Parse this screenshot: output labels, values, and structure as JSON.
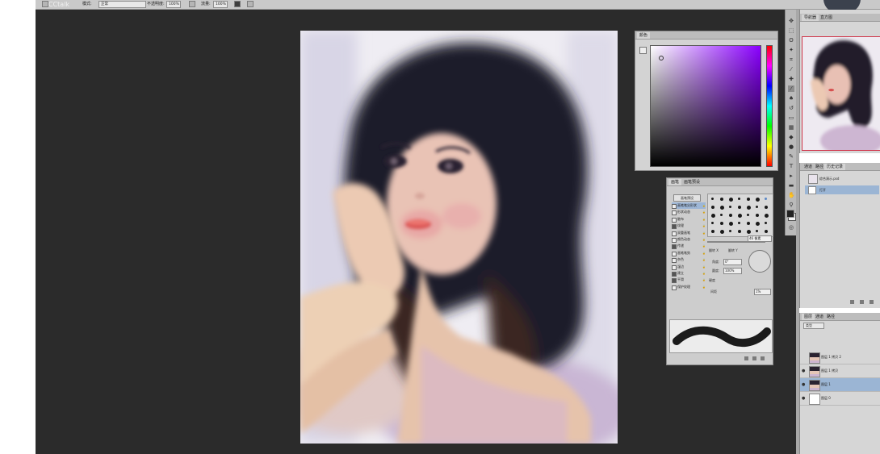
{
  "app": {
    "watermark": "CCtalk",
    "accent_color": "#2b2b2b"
  },
  "options_bar": {
    "mode_label": "模式:",
    "mode_value": "正常",
    "opacity_label": "不透明度:",
    "opacity_value": "100%",
    "flow_label": "流量:",
    "flow_value": "100%"
  },
  "color_panel": {
    "tab": "颜色",
    "hue": "#8a00ff"
  },
  "brush_panel": {
    "tabs": [
      "画笔",
      "画笔预设"
    ],
    "presets_button": "画笔预设",
    "items": [
      {
        "label": "画笔笔尖形状",
        "checked": false,
        "selected": true
      },
      {
        "label": "形状动态",
        "checked": false
      },
      {
        "label": "散布",
        "checked": false
      },
      {
        "label": "纹理",
        "checked": true
      },
      {
        "label": "双重画笔",
        "checked": false
      },
      {
        "label": "颜色动态",
        "checked": false
      },
      {
        "label": "传递",
        "checked": true
      },
      {
        "label": "画笔笔势",
        "checked": false
      },
      {
        "label": "杂色",
        "checked": false
      },
      {
        "label": "湿边",
        "checked": false
      },
      {
        "label": "建立",
        "checked": true
      },
      {
        "label": "平滑",
        "checked": true
      },
      {
        "label": "保护纹理",
        "checked": false
      }
    ],
    "size_value": "46 像素",
    "flip_x": "翻转 X",
    "flip_y": "翻转 Y",
    "angle_label": "角度:",
    "angle_value": "0°",
    "roundness_label": "圆度:",
    "roundness_value": "100%",
    "hardness_label": "硬度",
    "spacing_label": "间距",
    "spacing_value": "1%"
  },
  "navigator": {
    "tabs": [
      "导航器",
      "直方图"
    ]
  },
  "history": {
    "tabs": [
      "通道",
      "路径",
      "历史记录"
    ],
    "rows": [
      "综合演示.psd",
      "打开"
    ]
  },
  "layers": {
    "tabs": [
      "图层",
      "通道",
      "路径"
    ],
    "filter_label": "类型",
    "rows": [
      {
        "name": "图层 1 拷贝 2",
        "visible": false,
        "selected": false
      },
      {
        "name": "图层 1 拷贝",
        "visible": true,
        "selected": false
      },
      {
        "name": "图层 1",
        "visible": true,
        "selected": true
      },
      {
        "name": "图层 0",
        "visible": true,
        "selected": false
      }
    ]
  },
  "icons": {
    "visibility": "eye-icon",
    "brush_tool": "brush-icon"
  }
}
